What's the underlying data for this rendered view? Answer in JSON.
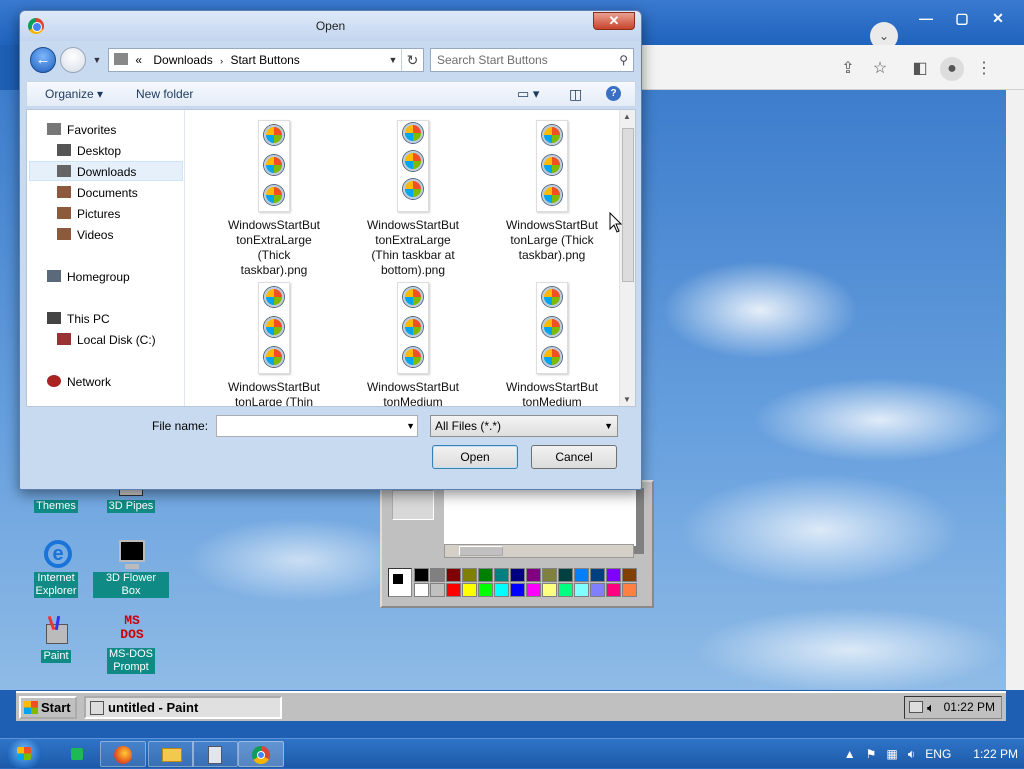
{
  "dialog": {
    "title": "Open",
    "address": {
      "chevron": "«",
      "segments": [
        "Downloads",
        "Start Buttons"
      ]
    },
    "search_placeholder": "Search Start Buttons",
    "commands": {
      "organize": "Organize",
      "new_folder": "New folder"
    },
    "nav": {
      "favorites": "Favorites",
      "desktop": "Desktop",
      "downloads": "Downloads",
      "documents": "Documents",
      "pictures": "Pictures",
      "videos": "Videos",
      "homegroup": "Homegroup",
      "this_pc": "This PC",
      "local_disk": "Local Disk (C:)",
      "network": "Network"
    },
    "files": [
      {
        "line1": "WindowsStartBut",
        "line2": "tonExtraLarge",
        "line3": "(Thick",
        "line4": "taskbar).png"
      },
      {
        "line1": "WindowsStartBut",
        "line2": "tonExtraLarge",
        "line3": "(Thin taskbar at",
        "line4": "bottom).png"
      },
      {
        "line1": "WindowsStartBut",
        "line2": "tonLarge (Thick",
        "line3": "taskbar).png",
        "line4": ""
      },
      {
        "line1": "WindowsStartBut",
        "line2": "tonLarge (Thin",
        "line3": "",
        "line4": ""
      },
      {
        "line1": "WindowsStartBut",
        "line2": "tonMedium",
        "line3": "",
        "line4": ""
      },
      {
        "line1": "WindowsStartBut",
        "line2": "tonMedium",
        "line3": "",
        "line4": ""
      }
    ],
    "file_name_label": "File name:",
    "file_name_value": "",
    "filter": "All Files (*.*)",
    "open_label": "Open",
    "cancel_label": "Cancel"
  },
  "desktop_icons": {
    "themes": "Themes",
    "pipes": "3D Pipes",
    "ie_line1": "Internet",
    "ie_line2": "Explorer",
    "flower": "3D Flower Box",
    "paint": "Paint",
    "msdos_line1": "MS-DOS",
    "msdos_line2": "Prompt"
  },
  "taskbar95": {
    "start": "Start",
    "task": "untitled - Paint",
    "clock": "01:22 PM"
  },
  "taskbar7": {
    "lang": "ENG",
    "clock": "1:22 PM"
  },
  "colors": {
    "palette_row1": [
      "#000000",
      "#808080",
      "#800000",
      "#808000",
      "#008000",
      "#008080",
      "#000080",
      "#800080",
      "#808040",
      "#004040",
      "#0080ff",
      "#004080",
      "#8000ff",
      "#804000"
    ],
    "palette_row2": [
      "#ffffff",
      "#c0c0c0",
      "#ff0000",
      "#ffff00",
      "#00ff00",
      "#00ffff",
      "#0000ff",
      "#ff00ff",
      "#ffff80",
      "#00ff80",
      "#80ffff",
      "#8080ff",
      "#ff0080",
      "#ff8040"
    ]
  }
}
